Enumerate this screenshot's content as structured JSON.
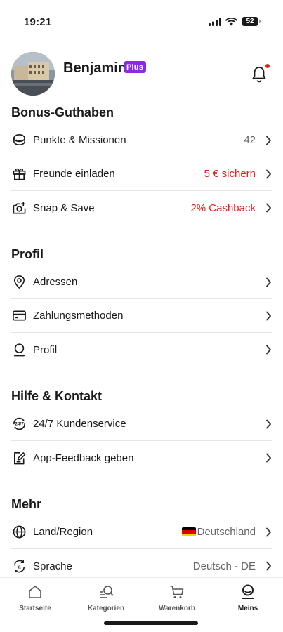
{
  "status_bar": {
    "time": "19:21",
    "battery": "52"
  },
  "header": {
    "name": "Benjamin",
    "badge": "Plus"
  },
  "sections": [
    {
      "title": "Bonus-Guthaben",
      "rows": [
        {
          "icon": "coins-icon",
          "label": "Punkte & Missionen",
          "value": "42",
          "value_color": "#666666"
        },
        {
          "icon": "gift-icon",
          "label": "Freunde einladen",
          "value": "5 € sichern",
          "value_color": "#e0201c"
        },
        {
          "icon": "camera-plus-icon",
          "label": "Snap & Save",
          "value": "2% Cashback",
          "value_color": "#e0201c"
        }
      ]
    },
    {
      "title": "Profil",
      "rows": [
        {
          "icon": "location-pin-icon",
          "label": "Adressen",
          "value": ""
        },
        {
          "icon": "credit-card-icon",
          "label": "Zahlungsmethoden",
          "value": ""
        },
        {
          "icon": "user-icon",
          "label": "Profil",
          "value": ""
        }
      ]
    },
    {
      "title": "Hilfe & Kontakt",
      "rows": [
        {
          "icon": "support-24-7-icon",
          "label": "24/7 Kundenservice",
          "value": ""
        },
        {
          "icon": "feedback-edit-icon",
          "label": "App-Feedback geben",
          "value": ""
        }
      ]
    },
    {
      "title": "Mehr",
      "rows": [
        {
          "icon": "globe-icon",
          "label": "Land/Region",
          "value": "Deutschland",
          "flag": "germany-flag"
        },
        {
          "icon": "language-icon",
          "label": "Sprache",
          "value": "Deutsch - DE"
        }
      ]
    }
  ],
  "tabs": [
    {
      "icon": "home-icon",
      "label": "Startseite",
      "active": false
    },
    {
      "icon": "categories-search-icon",
      "label": "Kategorien",
      "active": false
    },
    {
      "icon": "cart-icon",
      "label": "Warenkorb",
      "active": false
    },
    {
      "icon": "profile-icon",
      "label": "Meins",
      "active": true
    }
  ],
  "colors": {
    "accent_red": "#e0201c",
    "plus_purple": "#8a2be2"
  }
}
